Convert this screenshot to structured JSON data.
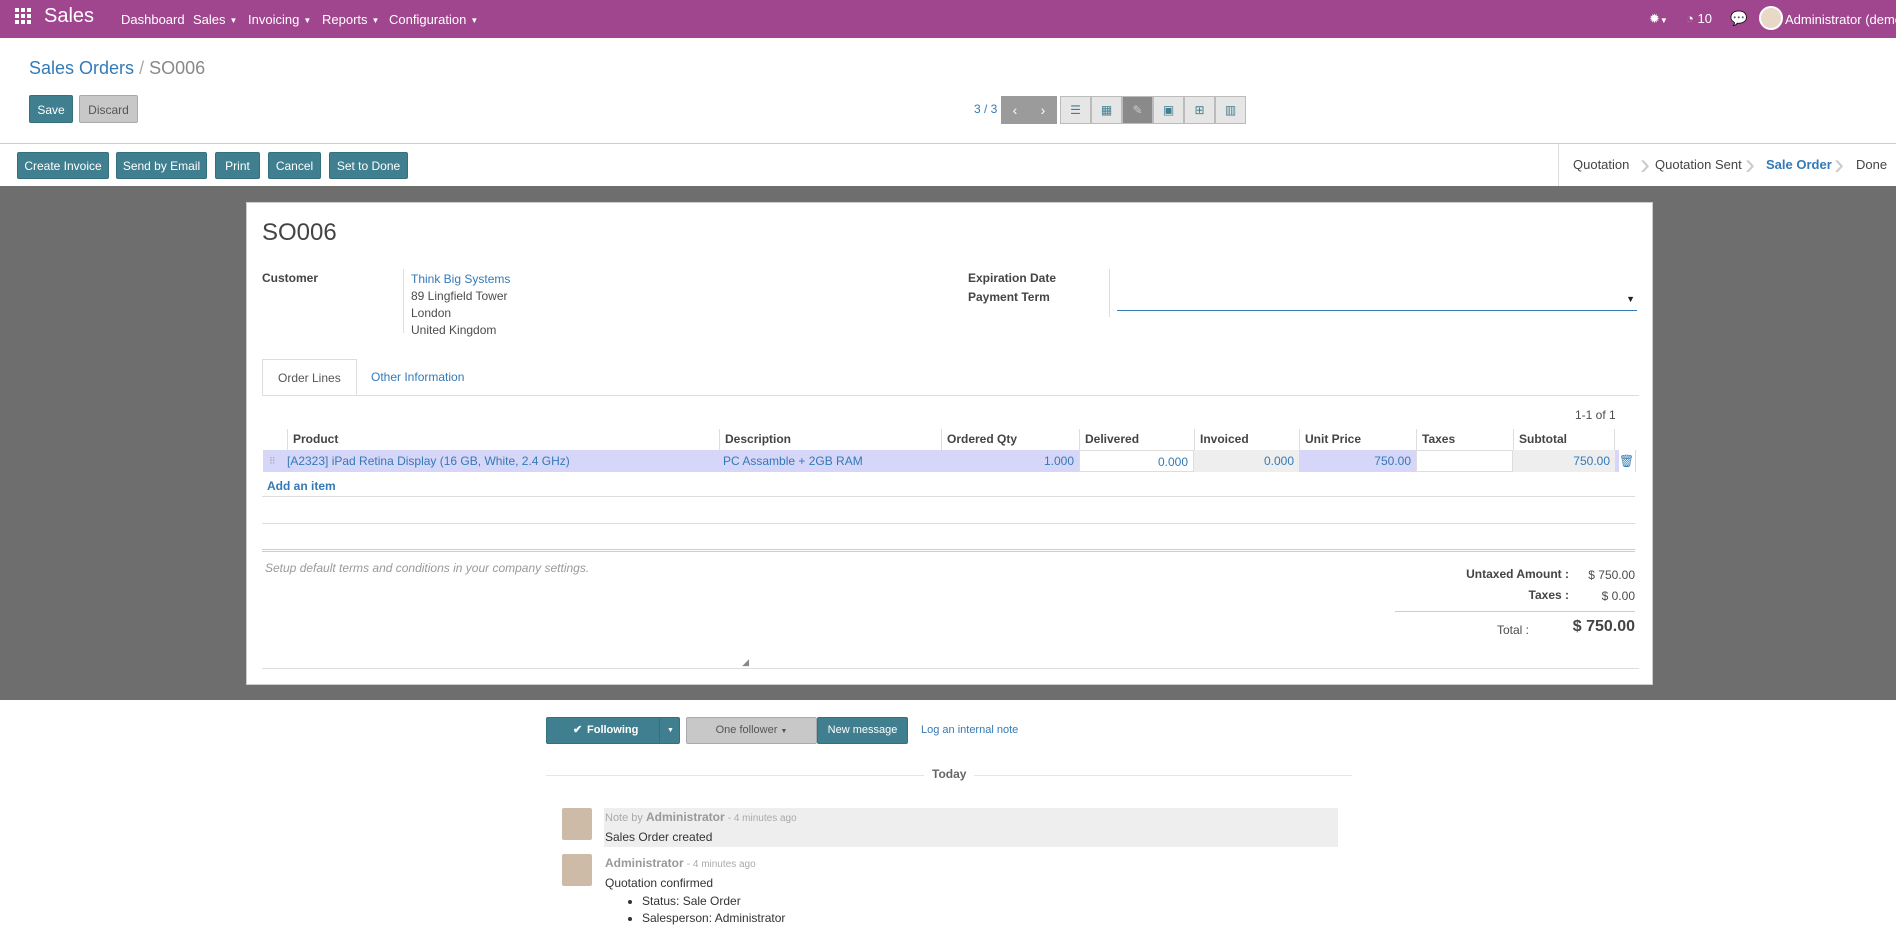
{
  "topbar": {
    "app_name": "Sales",
    "menus": [
      "Dashboard",
      "Sales",
      "Invoicing",
      "Reports",
      "Configuration"
    ],
    "activity_count": "10",
    "user": "Administrator (demo"
  },
  "breadcrumb": {
    "parent": "Sales Orders",
    "separator": "/",
    "current": "SO006"
  },
  "buttons": {
    "save": "Save",
    "discard": "Discard"
  },
  "pager": {
    "value": "3 / 3"
  },
  "header_buttons": [
    "Create Invoice",
    "Send by Email",
    "Print",
    "Cancel",
    "Set to Done"
  ],
  "stages": [
    "Quotation",
    "Quotation Sent",
    "Sale Order",
    "Done"
  ],
  "active_stage": "Sale Order",
  "form": {
    "title": "SO006",
    "customer_label": "Customer",
    "customer_name": "Think Big Systems",
    "address": [
      "89 Lingfield Tower",
      "London",
      "United Kingdom"
    ],
    "expiration_label": "Expiration Date",
    "payment_term_label": "Payment Term"
  },
  "tabs": [
    "Order Lines",
    "Other Information"
  ],
  "table": {
    "pager": "1-1 of 1",
    "columns": [
      "Product",
      "Description",
      "Ordered Qty",
      "Delivered",
      "Invoiced",
      "Unit Price",
      "Taxes",
      "Subtotal"
    ],
    "rows": [
      {
        "product": "[A2323] iPad Retina Display (16 GB, White, 2.4 GHz)",
        "description": "PC Assamble + 2GB RAM",
        "ordered": "1.000",
        "delivered": "0.000",
        "invoiced": "0.000",
        "unit_price": "750.00",
        "taxes": "",
        "subtotal": "750.00"
      }
    ],
    "add_item": "Add an item"
  },
  "terms_placeholder": "Setup default terms and conditions in your company settings.",
  "totals": {
    "untaxed_label": "Untaxed Amount :",
    "untaxed_value": "$ 750.00",
    "taxes_label": "Taxes :",
    "taxes_value": "$ 0.00",
    "total_label": "Total :",
    "total_value": "$ 750.00"
  },
  "chatter": {
    "following": "Following",
    "followers": "One follower",
    "new_message": "New message",
    "log_note": "Log an internal note",
    "today": "Today",
    "messages": [
      {
        "prefix": "Note by",
        "author": "Administrator",
        "time": "- 4 minutes ago",
        "body": "Sales Order created"
      },
      {
        "prefix": "",
        "author": "Administrator",
        "time": "- 4 minutes ago",
        "body": "Quotation confirmed",
        "bullets": [
          "Status: Sale Order",
          "Salesperson: Administrator"
        ]
      }
    ]
  }
}
